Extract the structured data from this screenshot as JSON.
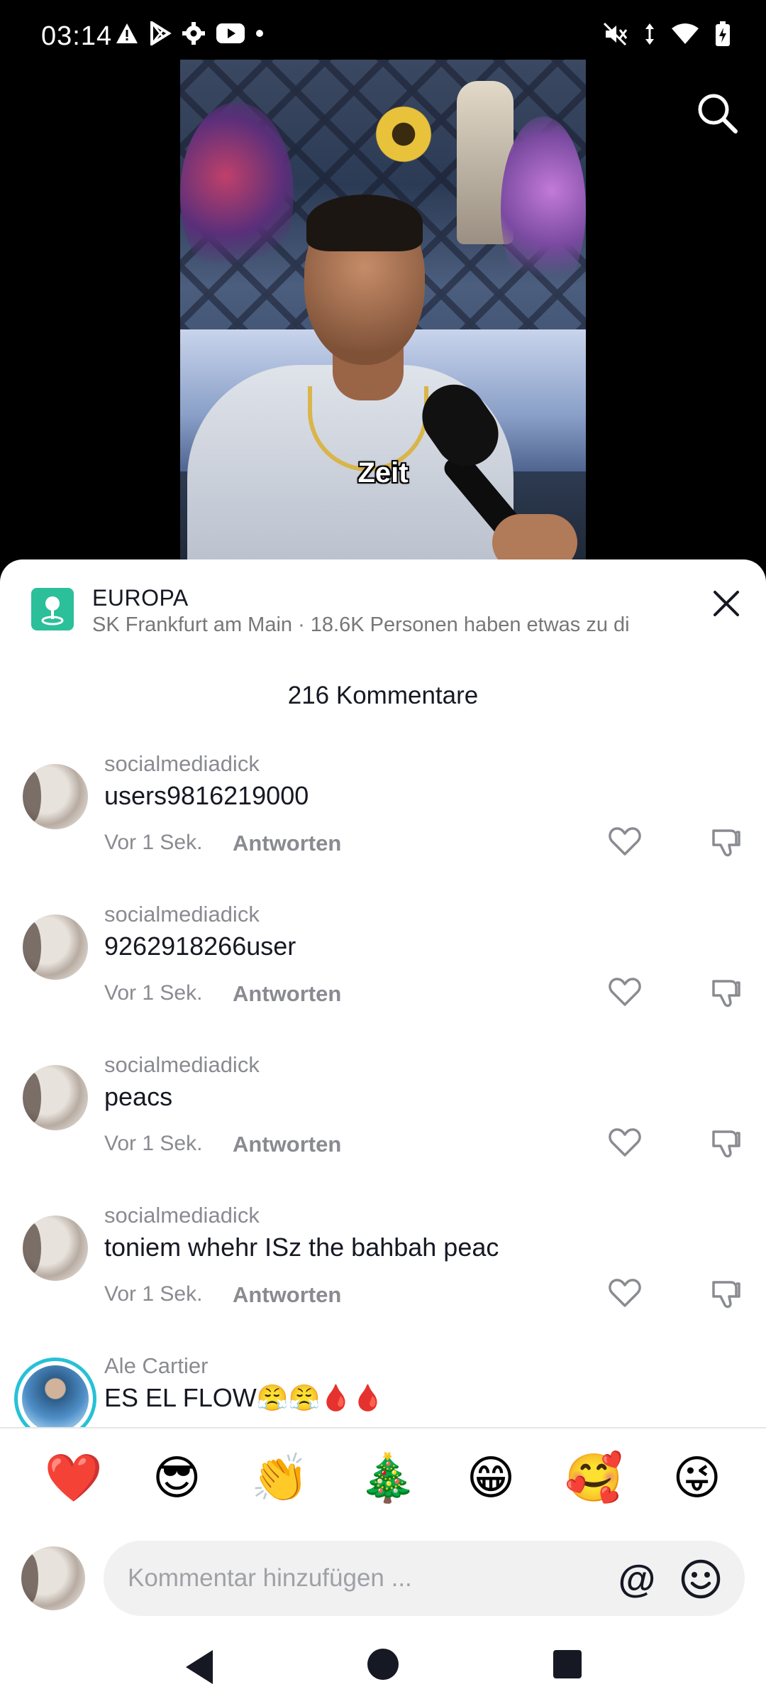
{
  "status_bar": {
    "time": "03:14",
    "left_icons": [
      "warning-icon",
      "play-store-icon",
      "settings-icon",
      "youtube-icon",
      "dot-icon"
    ],
    "right_icons": [
      "mute-icon",
      "data-arrows-icon",
      "wifi-icon",
      "battery-charging-icon"
    ]
  },
  "video": {
    "caption": "Zeit"
  },
  "location": {
    "title": "EUROPA",
    "subtitle": "SK Frankfurt am Main · 18.6K Personen haben etwas zu di"
  },
  "comments": {
    "header": "216 Kommentare",
    "items": [
      {
        "user": "socialmediadick",
        "text": "users9816219000",
        "time": "Vor 1 Sek.",
        "reply_label": "Antworten"
      },
      {
        "user": "socialmediadick",
        "text": "9262918266user",
        "time": "Vor 1 Sek.",
        "reply_label": "Antworten"
      },
      {
        "user": "socialmediadick",
        "text": "peacs",
        "time": "Vor 1 Sek.",
        "reply_label": "Antworten"
      },
      {
        "user": "socialmediadick",
        "text": "toniem whehr ISz the bahbah peac",
        "time": "Vor 1 Sek.",
        "reply_label": "Antworten"
      },
      {
        "user": "Ale Cartier",
        "text": "ES EL FLOW😤😤🩸🩸"
      }
    ]
  },
  "emoji_bar": [
    "❤️",
    "😎",
    "👏",
    "🎄",
    "😁",
    "🥰",
    "😜"
  ],
  "input": {
    "placeholder": "Kommentar hinzufügen ...",
    "at_label": "@"
  },
  "colors": {
    "accent_location": "#2bbf9a",
    "story_ring": "#27c1d6",
    "text_primary": "#161823",
    "text_secondary": "#8a8b91"
  }
}
